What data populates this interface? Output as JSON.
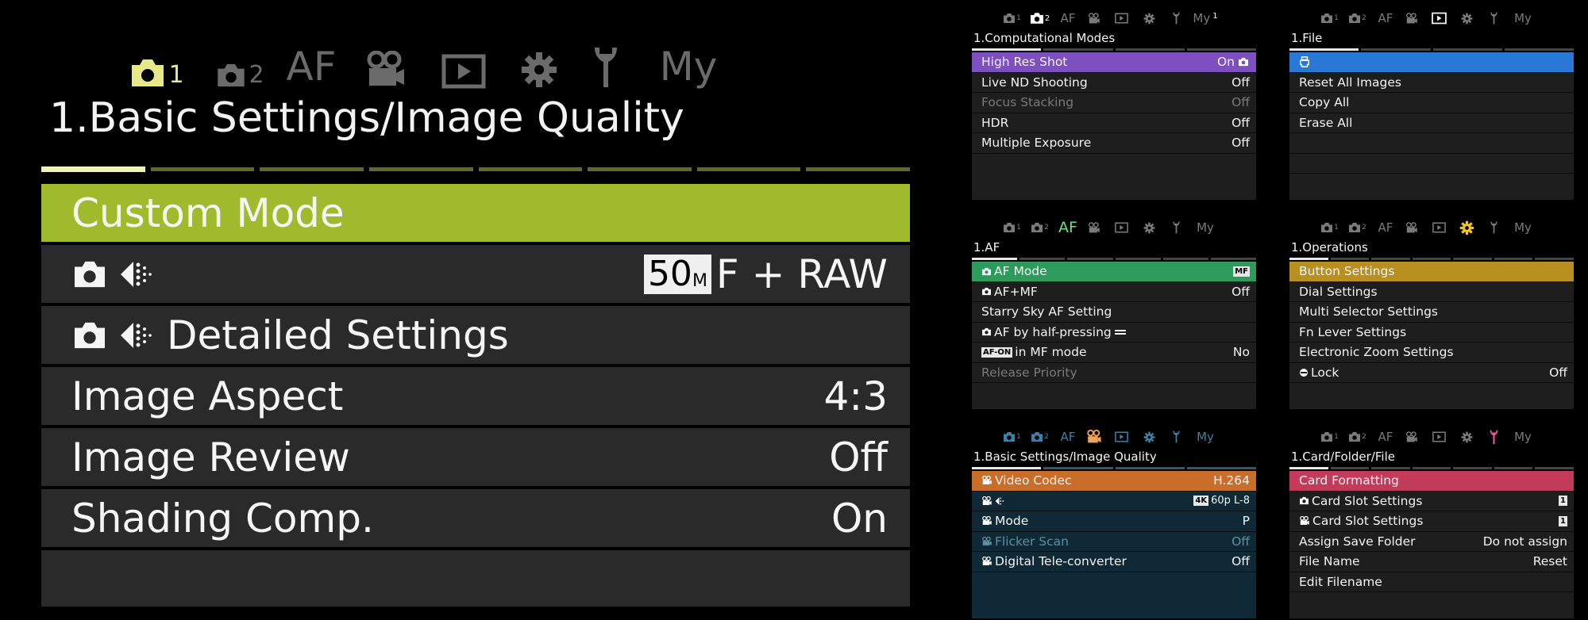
{
  "main_menu": {
    "tabs": [
      {
        "id": "photo1",
        "icon": "camera-icon",
        "sub": "1",
        "active": true
      },
      {
        "id": "photo2",
        "icon": "camera-icon",
        "sub": "2",
        "active": false
      },
      {
        "id": "af",
        "text": "AF",
        "active": false
      },
      {
        "id": "video",
        "icon": "movie-camera-icon",
        "active": false
      },
      {
        "id": "playback",
        "icon": "playback-icon",
        "active": false
      },
      {
        "id": "setup",
        "icon": "gear-icon",
        "active": false
      },
      {
        "id": "custom",
        "icon": "wrench-icon",
        "active": false
      },
      {
        "id": "my",
        "text": "My",
        "active": false
      }
    ],
    "heading": "1.Basic Settings/Image Quality",
    "items": [
      {
        "label": "Custom Mode",
        "value": ""
      },
      {
        "label": "",
        "value_mp": "50",
        "value_mp_unit": "M",
        "value": "F + RAW"
      },
      {
        "label": "Detailed Settings",
        "value": ""
      },
      {
        "label": "Image Aspect",
        "value": "4:3"
      },
      {
        "label": "Image Review",
        "value": "Off"
      },
      {
        "label": "Shading Comp.",
        "value": "On"
      }
    ],
    "accent_color": "#9fbb2d"
  },
  "panels": {
    "computational": {
      "title": "1.Computational Modes",
      "highlight_color": "#7e4fbf",
      "tab_color": "#ffffff",
      "items": [
        {
          "label": "High Res Shot",
          "value": "On"
        },
        {
          "label": "Live ND Shooting",
          "value": "Off"
        },
        {
          "label": "Focus Stacking",
          "value": "Off"
        },
        {
          "label": "HDR",
          "value": "Off"
        },
        {
          "label": "Multiple Exposure",
          "value": "Off"
        }
      ]
    },
    "file": {
      "title": "1.File",
      "highlight_color": "#2a78d6",
      "tab_color": "#ffffff",
      "items": [
        {
          "label": "",
          "value": ""
        },
        {
          "label": "Reset All Images",
          "value": ""
        },
        {
          "label": "Copy All",
          "value": ""
        },
        {
          "label": "Erase All",
          "value": ""
        }
      ]
    },
    "af": {
      "title": "1.AF",
      "highlight_color": "#2e9a5c",
      "tab_color": "#6fe08a",
      "af_on_badge": "AF-ON",
      "mf_badge": "MF",
      "items": [
        {
          "label": "AF Mode",
          "value": ""
        },
        {
          "label": "AF+MF",
          "value": "Off"
        },
        {
          "label": "Starry Sky AF Setting",
          "value": ""
        },
        {
          "label": "AF by half-pressing",
          "value": ""
        },
        {
          "label": "in MF mode",
          "value": "No"
        },
        {
          "label": "Release Priority",
          "value": ""
        }
      ]
    },
    "operations": {
      "title": "1.Operations",
      "highlight_color": "#b8901f",
      "tab_color": "#f0c23a",
      "items": [
        {
          "label": "Button Settings",
          "value": ""
        },
        {
          "label": "Dial Settings",
          "value": ""
        },
        {
          "label": "Multi Selector Settings",
          "value": ""
        },
        {
          "label": "Fn Lever Settings",
          "value": ""
        },
        {
          "label": "Electronic Zoom Settings",
          "value": ""
        },
        {
          "label": "Lock",
          "value": "Off"
        }
      ]
    },
    "video": {
      "title": "1.Basic Settings/Image Quality",
      "highlight_color": "#c96d2b",
      "tab_color": "#f0a35a",
      "badge_4k": "4K",
      "items": [
        {
          "label": "Video Codec",
          "value": "H.264"
        },
        {
          "label": "",
          "value": "60p L-8"
        },
        {
          "label": "Mode",
          "value": "P"
        },
        {
          "label": "Flicker Scan",
          "value": "Off"
        },
        {
          "label": "Digital Tele-converter",
          "value": "Off"
        }
      ]
    },
    "card": {
      "title": "1.Card/Folder/File",
      "highlight_color": "#c23b5a",
      "tab_color": "#e85a9a",
      "items": [
        {
          "label": "Card Formatting",
          "value": ""
        },
        {
          "label": "Card Slot Settings",
          "value": "1"
        },
        {
          "label": "Card Slot Settings",
          "value": "1"
        },
        {
          "label": "Assign Save Folder",
          "value": "Do not assign"
        },
        {
          "label": "File Name",
          "value": "Reset"
        },
        {
          "label": "Edit Filename",
          "value": ""
        }
      ]
    },
    "tab_labels": {
      "af": "AF",
      "my": "My",
      "sub1": "1",
      "sub2": "2"
    }
  }
}
